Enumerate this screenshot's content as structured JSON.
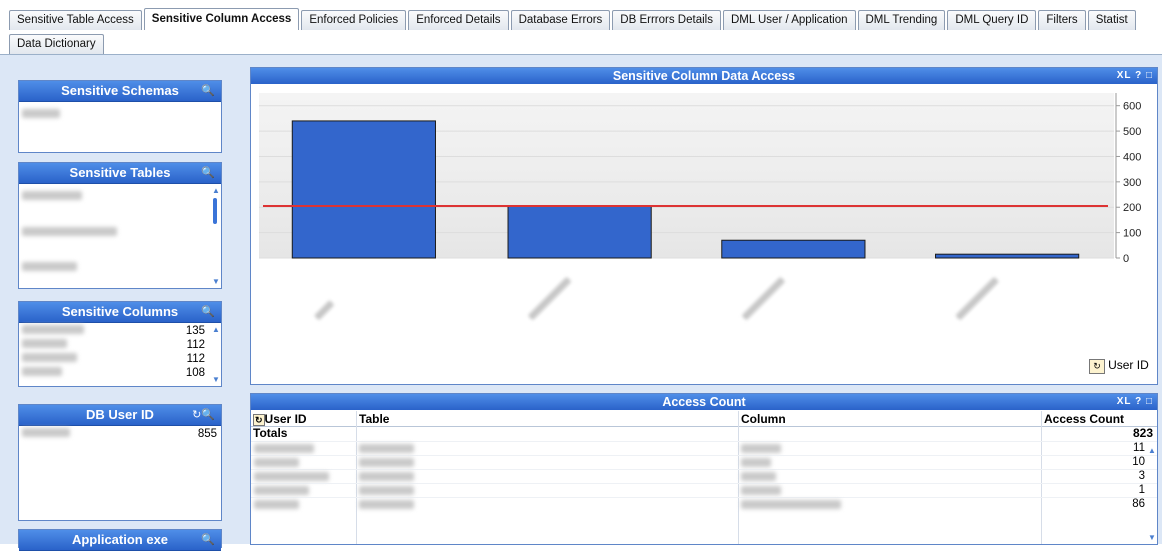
{
  "tabs_row1": [
    "Sensitive Table Access",
    "Sensitive Column Access",
    "Enforced Policies",
    "Enforced Details",
    "Database Errors",
    "DB Errrors Details",
    "DML User / Application",
    "DML Trending",
    "DML Query ID",
    "Filters",
    "Statist"
  ],
  "active_tab": "Sensitive Column Access",
  "tabs_row2": [
    "Data Dictionary"
  ],
  "listboxes": {
    "schemas": {
      "title": "Sensitive Schemas"
    },
    "tables": {
      "title": "Sensitive Tables"
    },
    "columns": {
      "title": "Sensitive Columns",
      "values": [
        "135",
        "112",
        "112",
        "108"
      ]
    },
    "users": {
      "title": "DB User ID",
      "values": [
        "855"
      ]
    },
    "apps": {
      "title": "Application exe"
    }
  },
  "chart_panel": {
    "title": "Sensitive Column Data Access",
    "icons_text": "XL ? □",
    "dimension_label": "User ID"
  },
  "chart_data": {
    "type": "bar",
    "values": [
      540,
      205,
      70,
      15
    ],
    "reference_line": 205,
    "ylim": [
      0,
      650
    ],
    "yticks": [
      "600",
      "500",
      "400",
      "300",
      "200",
      "100",
      "0"
    ],
    "colors": {
      "bar": "#3366cc",
      "reference": "#dd3333"
    }
  },
  "table_panel": {
    "title": "Access Count",
    "icons_text": "XL ? □"
  },
  "table": {
    "headers": [
      "User ID",
      "Table",
      "Column",
      "Access Count"
    ],
    "totals_label": "Totals",
    "totals_value": "823",
    "rows": [
      "11",
      "10",
      "3",
      "1",
      "86"
    ]
  }
}
